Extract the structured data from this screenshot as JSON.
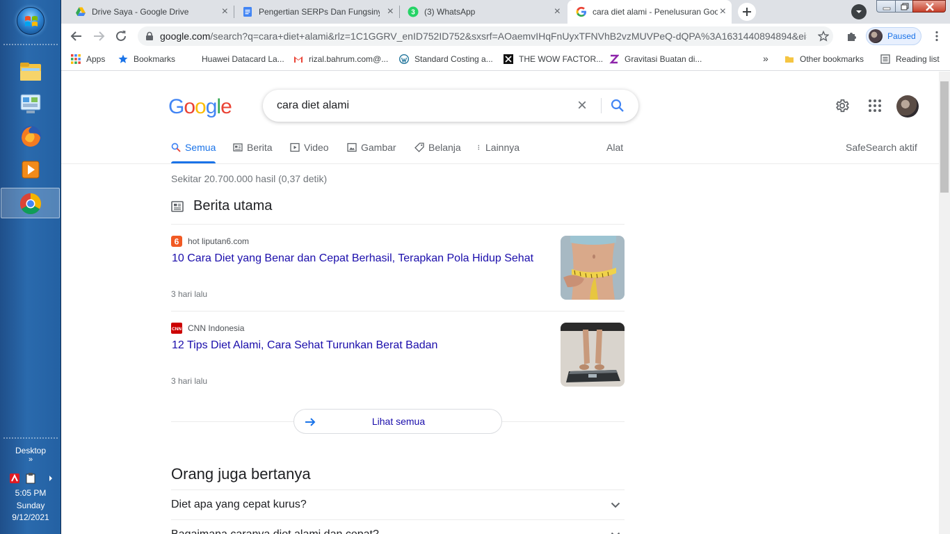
{
  "taskbar": {
    "desktop_label": "Desktop",
    "expand_glyph": "»",
    "time": "5:05 PM",
    "day": "Sunday",
    "date": "9/12/2021"
  },
  "tabs": [
    {
      "title": "Drive Saya - Google Drive",
      "icon": "google-drive-icon"
    },
    {
      "title": "Pengertian SERPs Dan Fungsinya",
      "icon": "google-docs-icon"
    },
    {
      "title": "(3) WhatsApp",
      "icon": "whatsapp-icon",
      "badge": "3"
    },
    {
      "title": "cara diet alami - Penelusuran Google",
      "icon": "google-g-icon",
      "active": true
    }
  ],
  "toolbar": {
    "url_host": "google.com",
    "url_rest": "/search?q=cara+diet+alami&rlz=1C1GGRV_enID752ID752&sxsrf=AOaemvIHqFnUyxTFNVhB2vzMUVPeQ-dQPA%3A1631440894894&ei=_...",
    "paused_label": "Paused"
  },
  "bookmarks": [
    {
      "label": "Apps",
      "icon": "apps-grid-icon"
    },
    {
      "label": "Bookmarks",
      "icon": "star-icon"
    },
    {
      "label": "Huawei Datacard La...",
      "icon": "huawei-icon"
    },
    {
      "label": "rizal.bahrum.com@...",
      "icon": "gmail-icon"
    },
    {
      "label": "Standard Costing a...",
      "icon": "wordpress-icon"
    },
    {
      "label": "THE WOW FACTOR...",
      "icon": "wow-factor-icon"
    },
    {
      "label": "Gravitasi Buatan di...",
      "icon": "zenius-icon"
    },
    {
      "label": "Other bookmarks",
      "icon": "folder-icon"
    },
    {
      "label": "Reading list",
      "icon": "reading-list-icon"
    }
  ],
  "bookmarks_overflow": "»",
  "search": {
    "logo": [
      "G",
      "o",
      "o",
      "g",
      "l",
      "e"
    ],
    "logo_colors": [
      "#4285f4",
      "#ea4335",
      "#fbbc05",
      "#4285f4",
      "#34a853",
      "#ea4335"
    ],
    "query": "cara diet alami",
    "clear_glyph": "×"
  },
  "search_tabs": [
    {
      "label": "Semua",
      "icon": "search-icon",
      "active": true
    },
    {
      "label": "Berita",
      "icon": "news-icon"
    },
    {
      "label": "Video",
      "icon": "video-icon"
    },
    {
      "label": "Gambar",
      "icon": "image-icon"
    },
    {
      "label": "Belanja",
      "icon": "tag-icon"
    },
    {
      "label": "Lainnya",
      "icon": "more-vert-icon"
    }
  ],
  "tools_label": "Alat",
  "safesearch_label": "SafeSearch aktif",
  "result_stats": "Sekitar 20.700.000 hasil (0,37 detik)",
  "top_stories": {
    "title": "Berita utama",
    "items": [
      {
        "source": "hot liputan6.com",
        "source_icon": "liputan6-icon",
        "headline": "10 Cara Diet yang Benar dan Cepat Berhasil, Terapkan Pola Hidup Sehat",
        "time": "3 hari lalu"
      },
      {
        "source": "CNN Indonesia",
        "source_icon": "cnn-icon",
        "headline": "12 Tips Diet Alami, Cara Sehat Turunkan Berat Badan",
        "time": "3 hari lalu"
      }
    ],
    "more_label": "Lihat semua"
  },
  "people_also_ask": {
    "title": "Orang juga bertanya",
    "questions": [
      "Diet apa yang cepat kurus?",
      "Bagaimana caranya diet alami dan cepat?"
    ]
  },
  "colors": {
    "link": "#1a0dab",
    "accent": "#1a73e8",
    "muted": "#70757a"
  }
}
